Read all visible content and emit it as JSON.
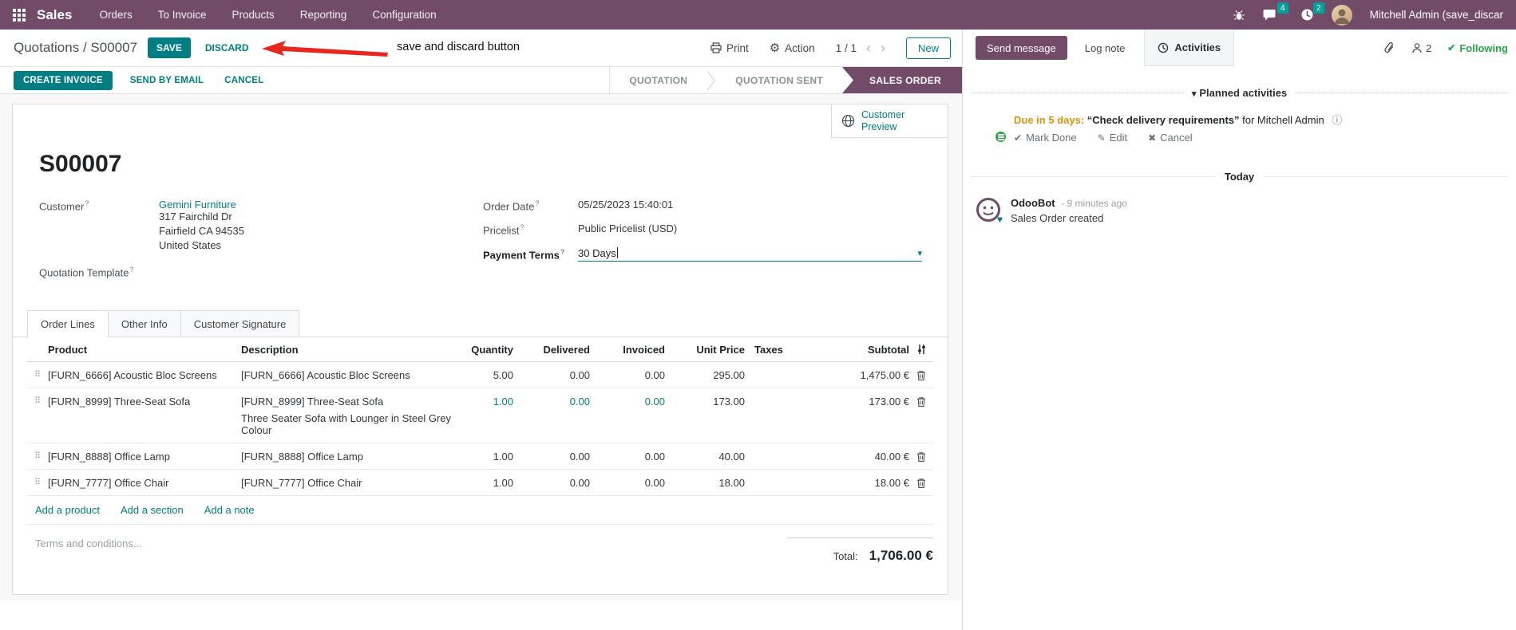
{
  "colors": {
    "brand": "#714B67",
    "accent": "#017E84",
    "badge": "#00A09D",
    "warning": "#d9930d",
    "success": "#28a745",
    "annotation_red": "#e8281e"
  },
  "icons": {
    "pager_prev": "‹",
    "pager_next": "›",
    "gear": "⚙",
    "caret_down": "▾",
    "drag_handle": "⠿",
    "check": "✔",
    "pencil": "✎",
    "cross": "✖",
    "info": "ⓘ",
    "heart": "♥"
  },
  "topnav": {
    "app_name": "Sales",
    "menus": [
      "Orders",
      "To Invoice",
      "Products",
      "Reporting",
      "Configuration"
    ],
    "message_badge": "4",
    "activity_badge": "2",
    "user_name": "Mitchell Admin (save_discar"
  },
  "control_panel": {
    "breadcrumb_parent": "Quotations",
    "breadcrumb_separator": " / ",
    "breadcrumb_current": "S00007",
    "save_label": "SAVE",
    "discard_label": "DISCARD",
    "annotation_text": "save and discard button",
    "print_label": "Print",
    "action_label": "Action",
    "pager_value": "1 / 1",
    "new_label": "New"
  },
  "statusbar": {
    "buttons": [
      "CREATE INVOICE",
      "SEND BY EMAIL",
      "CANCEL"
    ],
    "states": [
      "QUOTATION",
      "QUOTATION SENT",
      "SALES ORDER"
    ],
    "active_state": "SALES ORDER"
  },
  "form": {
    "name": "S00007",
    "help_marker": "?",
    "customer_label": "Customer",
    "customer_name": "Gemini Furniture",
    "customer_address": [
      "317 Fairchild Dr",
      "Fairfield CA 94535",
      "United States"
    ],
    "quotation_template_label": "Quotation Template",
    "order_date_label": "Order Date",
    "order_date_value": "05/25/2023 15:40:01",
    "pricelist_label": "Pricelist",
    "pricelist_value": "Public Pricelist (USD)",
    "payment_terms_label": "Payment Terms",
    "payment_terms_value": "30 Days",
    "customer_preview_line1": "Customer",
    "customer_preview_line2": "Preview",
    "tabs": [
      "Order Lines",
      "Other Info",
      "Customer Signature"
    ],
    "active_tab": "Order Lines"
  },
  "order_lines": {
    "columns": [
      "Product",
      "Description",
      "Quantity",
      "Delivered",
      "Invoiced",
      "Unit Price",
      "Taxes",
      "Subtotal"
    ],
    "rows": [
      {
        "product": "[FURN_6666] Acoustic Bloc Screens",
        "description": "[FURN_6666] Acoustic Bloc Screens",
        "description2": "",
        "quantity": "5.00",
        "delivered": "0.00",
        "invoiced": "0.00",
        "unit_price": "295.00",
        "taxes": "",
        "subtotal": "1,475.00 €",
        "highlight": false
      },
      {
        "product": "[FURN_8999] Three-Seat Sofa",
        "description": "[FURN_8999] Three-Seat Sofa",
        "description2": "Three Seater Sofa with Lounger in Steel Grey Colour",
        "quantity": "1.00",
        "delivered": "0.00",
        "invoiced": "0.00",
        "unit_price": "173.00",
        "taxes": "",
        "subtotal": "173.00 €",
        "highlight": true
      },
      {
        "product": "[FURN_8888] Office Lamp",
        "description": "[FURN_8888] Office Lamp",
        "description2": "",
        "quantity": "1.00",
        "delivered": "0.00",
        "invoiced": "0.00",
        "unit_price": "40.00",
        "taxes": "",
        "subtotal": "40.00 €",
        "highlight": false
      },
      {
        "product": "[FURN_7777] Office Chair",
        "description": "[FURN_7777] Office Chair",
        "description2": "",
        "quantity": "1.00",
        "delivered": "0.00",
        "invoiced": "0.00",
        "unit_price": "18.00",
        "taxes": "",
        "subtotal": "18.00 €",
        "highlight": false
      }
    ],
    "footer_links": [
      "Add a product",
      "Add a section",
      "Add a note"
    ],
    "terms_placeholder": "Terms and conditions...",
    "total_label": "Total:",
    "total_value": "1,706.00 €"
  },
  "chatter": {
    "send_message_label": "Send message",
    "log_note_label": "Log note",
    "activities_label": "Activities",
    "follower_count": "2",
    "following_label": "Following",
    "planned_title": "Planned activities",
    "activity": {
      "due": "Due in 5 days:",
      "summary": "“Check delivery requirements”",
      "assignee": "for Mitchell Admin",
      "mark_done": "Mark Done",
      "edit": "Edit",
      "cancel": "Cancel"
    },
    "today_label": "Today",
    "message": {
      "author": "OdooBot",
      "time": "- 9 minutes ago",
      "body": "Sales Order created"
    }
  }
}
